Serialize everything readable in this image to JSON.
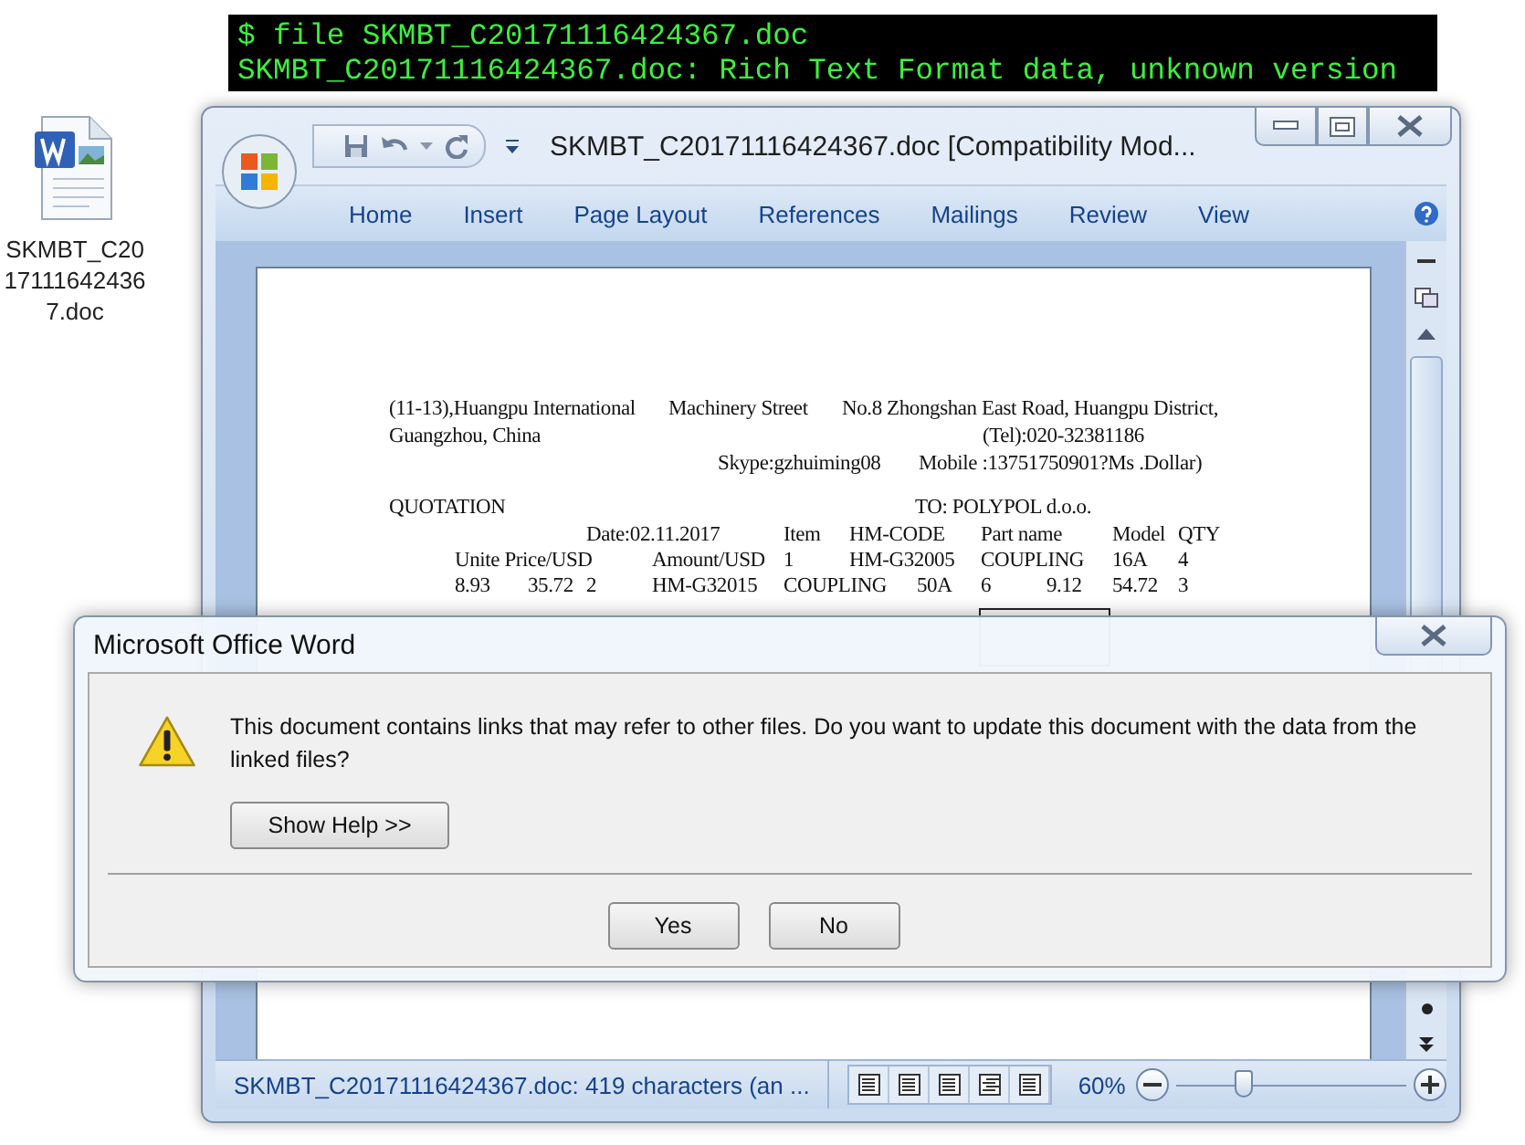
{
  "terminal": {
    "lines": [
      "$ file SKMBT_C20171116424367.doc",
      "SKMBT_C20171116424367.doc: Rich Text Format data, unknown version"
    ]
  },
  "desktop_icon": {
    "label": "SKMBT_C20171116424367.doc"
  },
  "word_window": {
    "title": "SKMBT_C20171116424367.doc [Compatibility Mod...",
    "ribbon_tabs": [
      {
        "label": "Home",
        "selected": false
      },
      {
        "label": "Insert",
        "selected": false
      },
      {
        "label": "Page Layout",
        "selected": false
      },
      {
        "label": "References",
        "selected": false
      },
      {
        "label": "Mailings",
        "selected": false
      },
      {
        "label": "Review",
        "selected": false
      },
      {
        "label": "View",
        "selected": false
      }
    ],
    "document": {
      "lines": [
        [
          "(11-13),Huangpu International",
          "Machinery Street",
          "No.8 Zhongshan East Road, Huangpu District,"
        ],
        [
          "Guangzhou, China",
          "(Tel):020-32381186"
        ],
        [
          "Skype:gzhuiming08",
          "Mobile :13751750901?Ms .Dollar)"
        ],
        [
          "QUOTATION",
          "TO: POLYPOL d.o.o."
        ],
        [
          "Date:02.11.2017",
          "Item",
          "HM-CODE",
          "Part name",
          "Model",
          "QTY"
        ],
        [
          "Unite Price/USD",
          "Amount/USD",
          "1",
          "HM-G32005",
          "COUPLING",
          "16A",
          "4"
        ],
        [
          "8.93",
          "35.72",
          "2",
          "HM-G32015",
          "COUPLING",
          "50A",
          "6",
          "9.12",
          "54.72",
          "3"
        ]
      ]
    },
    "status_bar": {
      "text": "SKMBT_C20171116424367.doc: 419 characters (an ...",
      "zoom": "60%",
      "level": 0.29
    }
  },
  "dialog": {
    "title": "Microsoft Office Word",
    "message": "This document contains links that may refer to other files. Do you want to update this document with the data from the linked files?",
    "help_button": "Show Help >>",
    "buttons": [
      "Yes",
      "No"
    ]
  }
}
